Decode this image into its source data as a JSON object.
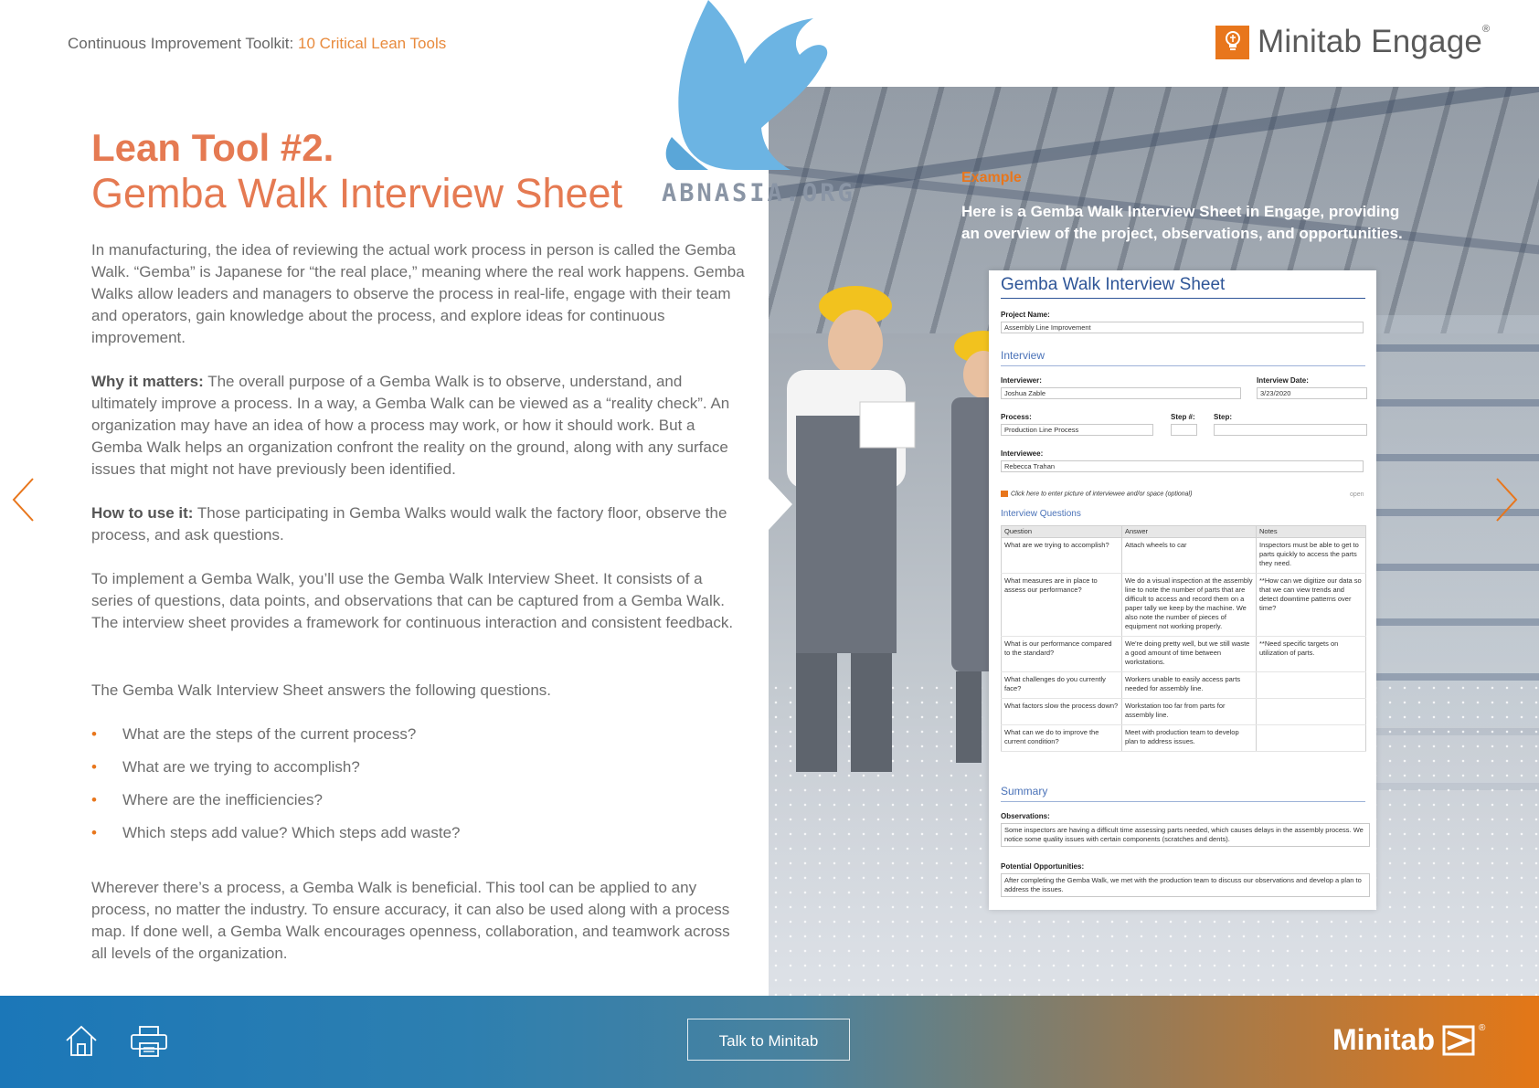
{
  "header": {
    "breadcrumb_prefix": "Continuous Improvement Toolkit:",
    "breadcrumb_link": "10 Critical Lean Tools",
    "brand_name": "Minitab Engage",
    "brand_mark": "®"
  },
  "watermark": {
    "text": "ABNASIA.ORG"
  },
  "title": {
    "line1": "Lean Tool #2.",
    "line2": "Gemba Walk Interview Sheet"
  },
  "body": {
    "intro": "In manufacturing, the idea of reviewing the actual work process in person is called the Gemba Walk. “Gemba” is Japanese for “the real place,” meaning where the real work happens. Gemba Walks allow leaders and managers to observe the process in real-life, engage with their team and operators, gain knowledge about the process, and explore ideas for continuous improvement.",
    "why_label": "Why it matters:",
    "why_text": " The overall purpose of a Gemba Walk is to observe, understand, and ultimately improve a process. In a way, a Gemba Walk can be viewed as a “reality check”. An organization may have an idea of how a process may work, or how it should work. But a Gemba Walk helps an organization confront the reality on the ground, along with any surface issues that might not have previously been identified.",
    "how_label": "How to use it:",
    "how_text": " Those participating in Gemba Walks would walk the factory floor, observe the process, and ask questions.",
    "implement": "To implement a Gemba Walk, you’ll use the Gemba Walk Interview Sheet. It consists of a series of questions, data points, and observations that can be captured from a Gemba Walk. The interview sheet provides a framework for continuous interaction and consistent feedback.",
    "answers_intro": "The Gemba Walk Interview Sheet answers the following questions.",
    "bullet_glyph": "•",
    "bullets": [
      "What are the steps of the current process?",
      "What are we trying to accomplish?",
      "Where are the inefficiencies?",
      "Which steps add value? Which steps add waste?"
    ],
    "closing": "Wherever there’s a process, a Gemba Walk is beneficial. This tool can be applied to any process, no matter the industry. To ensure accuracy, it can also be used along with a process map. If done well, a Gemba Walk encourages openness, collaboration, and teamwork across all levels of the organization."
  },
  "example": {
    "label": "Example",
    "text": "Here is a Gemba Walk Interview Sheet in Engage, providing an overview of the project, observations, and opportunities."
  },
  "sheet": {
    "title": "Gemba Walk Interview Sheet",
    "project_label": "Project Name:",
    "project_value": "Assembly Line Improvement",
    "interview_heading": "Interview",
    "interviewer_label": "Interviewer:",
    "interviewer_value": "Joshua Zable",
    "date_label": "Interview Date:",
    "date_value": "3/23/2020",
    "process_label": "Process:",
    "process_value": "Production Line Process",
    "step_num_label": "Step #:",
    "step_label": "Step:",
    "interviewee_label": "Interviewee:",
    "interviewee_value": "Rebecca Trahan",
    "picture_note": "Click here to enter picture of interviewee and/or space (optional)",
    "picture_open": "open",
    "questions_heading": "Interview Questions",
    "columns": [
      "Question",
      "Answer",
      "Notes"
    ],
    "rows": [
      [
        "What are we trying to accomplish?",
        "Attach wheels to car",
        "Inspectors must be able to get to parts quickly to access the parts they need."
      ],
      [
        "What measures are in place to assess our performance?",
        "We do a visual inspection at the assembly line to note the number of parts that are difficult to access and record them on a paper tally we keep by the machine. We also note the number of pieces of equipment not working properly.",
        "**How can we digitize our data so that we can view trends and detect downtime patterns over time?"
      ],
      [
        "What is our performance compared to the standard?",
        "We're doing pretty well, but we still waste a good amount of time between workstations.",
        "**Need specific targets on utilization of parts."
      ],
      [
        "What challenges do you currently face?",
        "Workers unable to easily access parts needed for assembly line.",
        ""
      ],
      [
        "What factors slow the process down?",
        "Workstation too far from parts for assembly line.",
        ""
      ],
      [
        "What can we do to improve the current condition?",
        "Meet with production team to develop plan to address issues.",
        ""
      ]
    ],
    "summary_heading": "Summary",
    "observations_label": "Observations:",
    "observations_value": "Some inspectors are having a difficult time assessing parts needed, which causes delays in the assembly process. We notice some quality issues with certain components (scratches and dents).",
    "opportunities_label": "Potential Opportunities:",
    "opportunities_value": "After completing the Gemba Walk, we met with the production team to discuss our observations and develop a plan to address the issues."
  },
  "footer": {
    "cta_label": "Talk to Minitab",
    "brand_name": "Minitab",
    "brand_mark": "®"
  },
  "icons": [
    "home-icon",
    "print-icon",
    "prev-arrow-icon",
    "next-arrow-icon",
    "minitab-engage-logo-icon",
    "minitab-logo-icon",
    "griffin-watermark-icon",
    "camera-icon"
  ],
  "colors": {
    "accent_orange": "#e8761c",
    "title_salmon": "#e57a52",
    "sheet_blue": "#2e5597",
    "footer_blue": "#1b77b8",
    "footer_orange": "#e47716"
  }
}
